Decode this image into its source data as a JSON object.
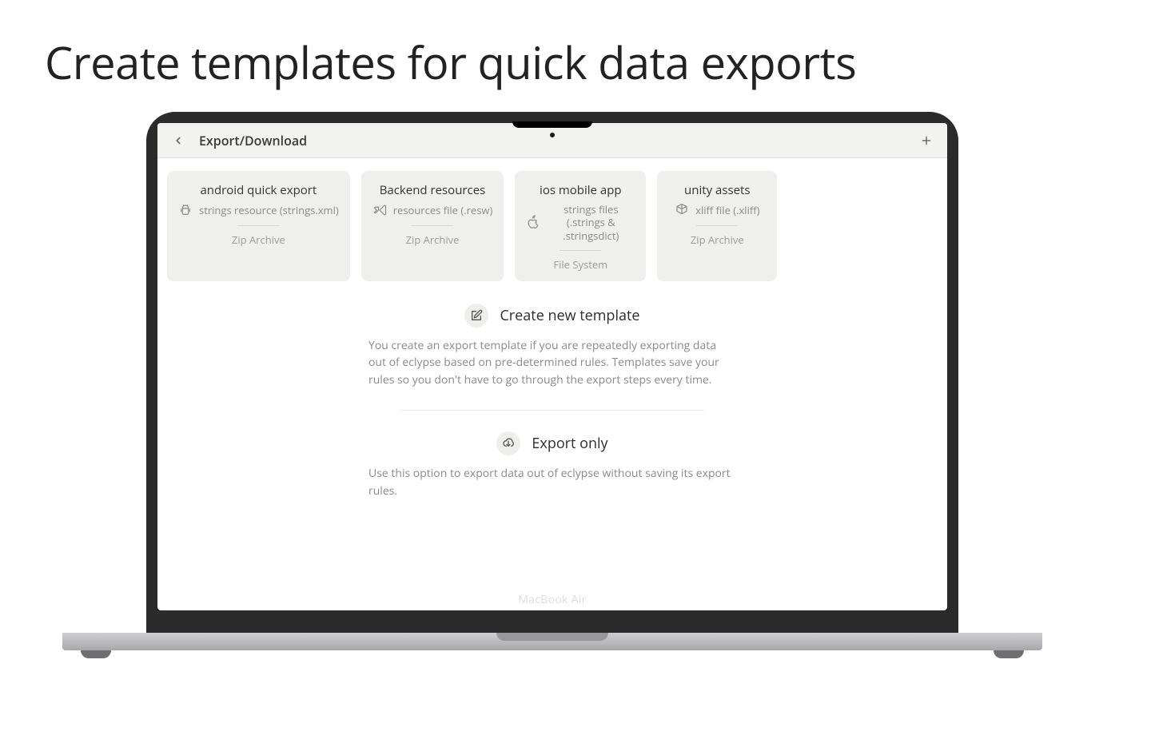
{
  "marketing": {
    "headline": "Create templates for quick data exports"
  },
  "laptop_model_label": "MacBook Air",
  "topbar": {
    "title": "Export/Download",
    "back_icon": "chevron-left",
    "plus_icon": "plus"
  },
  "template_cards": [
    {
      "title": "android quick export",
      "platform_icon": "android",
      "subtitle": "strings resource (strings.xml)",
      "destination": "Zip Archive"
    },
    {
      "title": "Backend resources",
      "platform_icon": "vs",
      "subtitle": "resources file (.resw)",
      "destination": "Zip Archive"
    },
    {
      "title": "ios mobile app",
      "platform_icon": "apple",
      "subtitle": "strings files (.strings & .stringsdict)",
      "destination": "File System"
    },
    {
      "title": "unity assets",
      "platform_icon": "unity",
      "subtitle": "xliff file (.xliff)",
      "destination": "Zip Archive"
    }
  ],
  "actions": {
    "create_template": {
      "title": "Create new template",
      "description": "You create an export template if you are repeatedly exporting data out of eclypse based on pre-determined rules. Templates save your rules so you don't have to go through the export steps every time."
    },
    "export_only": {
      "title": "Export only",
      "description": "Use this option to export data out of eclypse without saving its export rules."
    }
  }
}
